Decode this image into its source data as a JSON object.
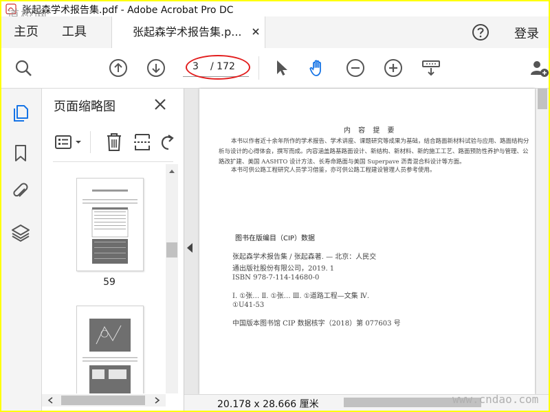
{
  "window": {
    "title": "张起森学术报告集.pdf - Adobe Acrobat Pro DC",
    "watermark": "道桥网"
  },
  "tabs": {
    "home": "主页",
    "tools": "工具",
    "document": "张起森学术报告集.p...",
    "login": "登录"
  },
  "toolbar": {
    "page_current": "3",
    "page_total": "/ 172"
  },
  "thumbnails": {
    "title": "页面缩略图",
    "pages": [
      {
        "label": "59"
      },
      {
        "label": ""
      }
    ]
  },
  "document": {
    "abstract_title": "内 容 提 要",
    "abstract_p1": "本书以作者近十余年所作的学术报告、学术讲座、课题研究等成果为基础，结合路面新材料试验与应用、路面结构分析与设计的心得体会，撰写而成。内容涵盖路基路面设计、新结构、新材料、新的施工工艺、路面预防性养护与管理、公路改扩建、美国 AASHTO 设计方法、长寿命路面与美国 Superpave 沥青混合料设计等方面。",
    "abstract_p2": "本书可供公路工程研究人员学习借鉴，亦可供公路工程建设管理人员参考使用。",
    "cip_title": "图书在版编目（CIP）数据",
    "cip_line1": "张起森学术报告集 / 张起森著. — 北京：人民交",
    "cip_line2": "通出版社股份有限公司，2019. 1",
    "cip_line3": "ISBN  978-7-114-14680-0",
    "cip_line4": "Ⅰ. ①张…  Ⅱ. ①张…  Ⅲ. ①道路工程—文集  Ⅳ.",
    "cip_line5": "①U41-53",
    "cip_line6": "中国版本图书馆 CIP 数据核字（2018）第 077603 号"
  },
  "status": {
    "dimensions": "20.178 x 28.666 厘米",
    "watermark": "www.cndao.com"
  },
  "colors": {
    "accent": "#1473e6",
    "highlight": "#e21c1c",
    "frame": "#ffff00"
  }
}
